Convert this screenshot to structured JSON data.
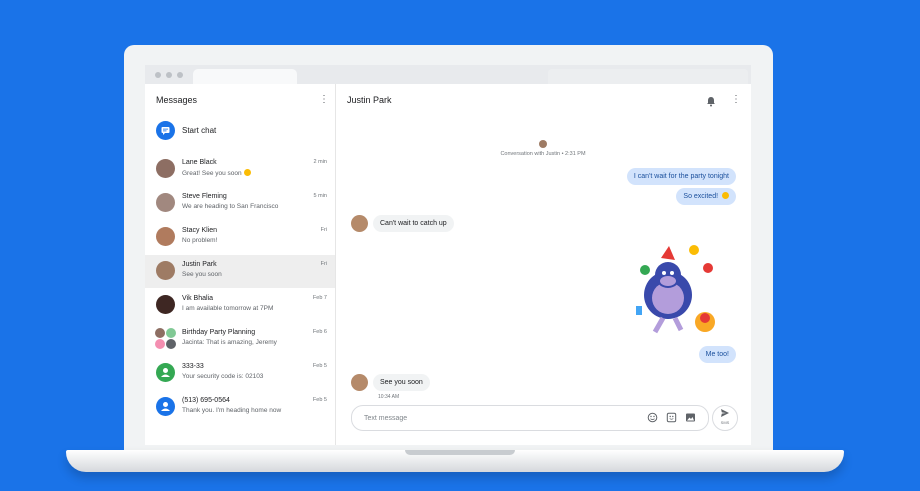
{
  "left_pane": {
    "title": "Messages",
    "menu_icon": "more-vert-icon",
    "start_chat": {
      "label": "Start chat",
      "icon": "chat-icon"
    }
  },
  "conversations": [
    {
      "name": "Lane Black",
      "preview": "Great! See you soon",
      "time": "2 min",
      "avatar_color": "#8d6e63"
    },
    {
      "name": "Steve Fleming",
      "preview": "We are heading to San Francisco",
      "time": "5 min",
      "avatar_color": "#a1887f"
    },
    {
      "name": "Stacy Klien",
      "preview": "No problem!",
      "time": "Fri",
      "avatar_color": "#b07b5e"
    },
    {
      "name": "Justin Park",
      "preview": "See you soon",
      "time": "Fri",
      "avatar_color": "#9e7b64"
    },
    {
      "name": "Vik Bhalia",
      "preview": "I am available tomorrow at 7PM",
      "time": "Feb 7",
      "avatar_color": "#3e2723"
    },
    {
      "name": "Birthday Party Planning",
      "preview": "Jacinta: That is amazing, Jeremy",
      "time": "Feb 6",
      "avatar_color": "#f48fb1"
    },
    {
      "name": "333-33",
      "preview": "Your security code is: 02103",
      "time": "Feb 5",
      "avatar_color": "#34a853"
    },
    {
      "name": "(513) 695-0564",
      "preview": "Thank you. I'm heading home now",
      "time": "Feb 5",
      "avatar_color": "#1a73e8"
    }
  ],
  "conversation": {
    "title": "Justin Park",
    "notification_icon": "bell-icon",
    "menu_icon": "more-vert-icon",
    "system_note": "Conversation with Justin • 2:31 PM",
    "messages": [
      {
        "text": "I can't wait for the party tonight"
      },
      {
        "text": "So excited!"
      },
      {
        "text": "Can't wait to catch up"
      },
      {
        "text": "Me too!"
      },
      {
        "text": "See you soon",
        "time": "10:34 AM"
      }
    ],
    "sticker": "party-monster-sticker"
  },
  "compose": {
    "placeholder": "Text message",
    "send_label": "SMS",
    "icons": [
      "emoji-icon",
      "sticker-icon",
      "image-icon",
      "send-icon"
    ]
  },
  "colors": {
    "background": "#1a73e8",
    "outgoing_bubble": "#d2e3fc",
    "incoming_bubble": "#f1f3f4",
    "accent": "#1a73e8"
  }
}
